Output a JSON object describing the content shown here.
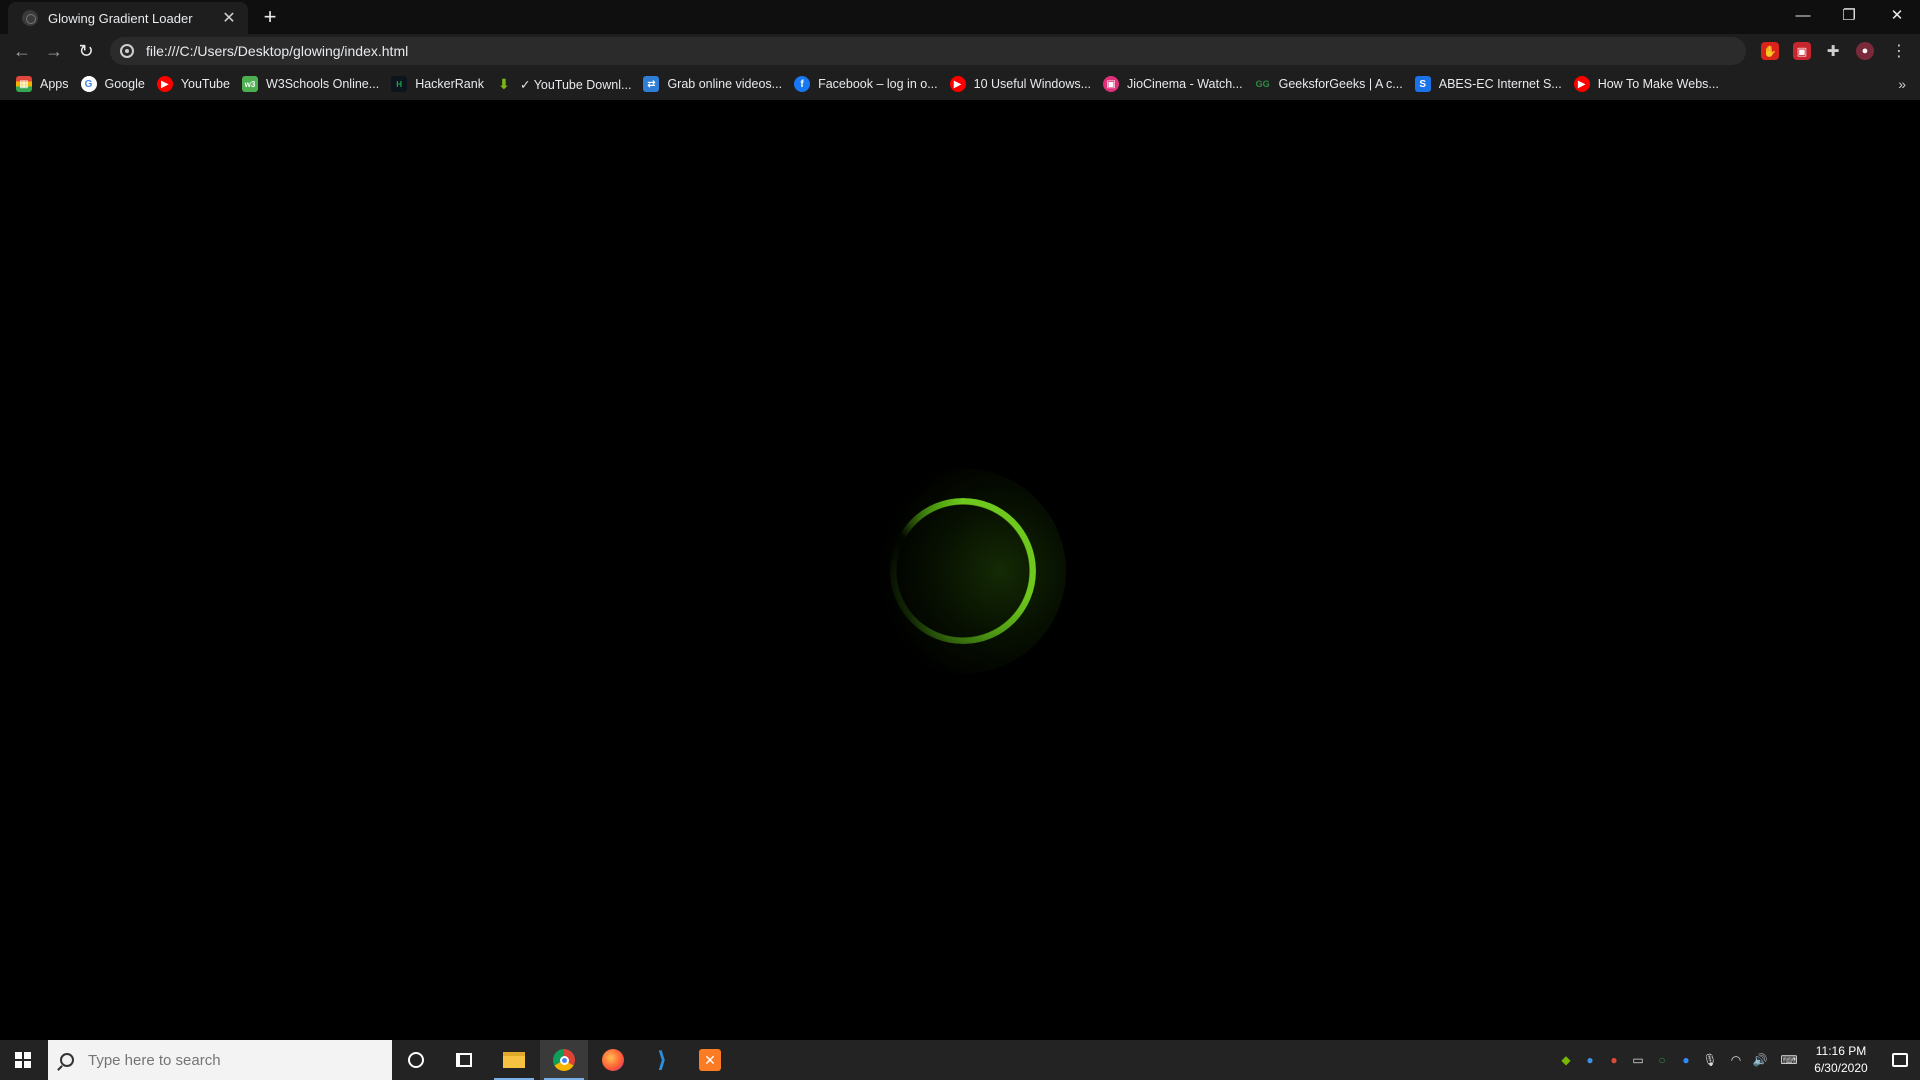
{
  "browser": {
    "tab_title": "Glowing Gradient Loader",
    "tab_close": "✕",
    "new_tab": "+",
    "window_controls": {
      "minimize": "—",
      "restore": "❐",
      "close": "✕"
    },
    "nav": {
      "back": "←",
      "forward": "→",
      "reload": "↻"
    },
    "url": "file:///C:/Users/Desktop/glowing/index.html",
    "menu": "⋮"
  },
  "bookmarks": {
    "items": [
      {
        "label": "Apps",
        "icon": "apps-grid-icon",
        "color": "#e0463a"
      },
      {
        "label": "Google",
        "icon": "google-icon",
        "color": "#ffffff"
      },
      {
        "label": "YouTube",
        "icon": "youtube-icon",
        "color": "#ff0000"
      },
      {
        "label": "W3Schools Online...",
        "icon": "w3schools-icon",
        "color": "#4caf50"
      },
      {
        "label": "HackerRank",
        "icon": "hackerrank-icon",
        "color": "#1ba94c"
      },
      {
        "label": "✓ YouTube Downl...",
        "icon": "download-arrow-icon",
        "color": "#7cb518"
      },
      {
        "label": "Grab online videos...",
        "icon": "grab-video-icon",
        "color": "#2f7ed8"
      },
      {
        "label": "Facebook – log in o...",
        "icon": "facebook-icon",
        "color": "#1877f2"
      },
      {
        "label": "10 Useful Windows...",
        "icon": "youtube-icon",
        "color": "#ff0000"
      },
      {
        "label": "JioCinema - Watch...",
        "icon": "jiocinema-icon",
        "color": "#e0307a"
      },
      {
        "label": "GeeksforGeeks | A c...",
        "icon": "geeksforgeeks-icon",
        "color": "#2f8d46"
      },
      {
        "label": "ABES-EC Internet S...",
        "icon": "sify-icon",
        "color": "#1a73e8"
      },
      {
        "label": "How To Make Webs...",
        "icon": "youtube-icon",
        "color": "#ff0000"
      }
    ],
    "more": "»"
  },
  "page": {
    "loader_color": "#6ec81e",
    "background": "#000000"
  },
  "taskbar": {
    "search_placeholder": "Type here to search",
    "time": "11:16 PM",
    "date": "6/30/2020"
  }
}
